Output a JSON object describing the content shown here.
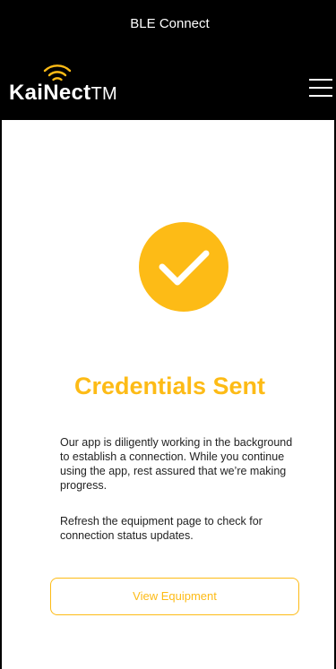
{
  "header": {
    "title": "BLE Connect",
    "logo_name": "KaiNect",
    "logo_mark": "TM",
    "menu_icon": "hamburger-menu-icon",
    "logo_icon": "wifi-signal-icon"
  },
  "main": {
    "status_icon": "checkmark-icon",
    "heading": "Credentials Sent",
    "paragraph_1": "Our app is diligently working in the background to establish a connection. While you continue using the app, rest assured that we’re making progress.",
    "paragraph_2": "Refresh the equipment page to check for connection status updates.",
    "button_label": "View Equipment"
  },
  "colors": {
    "accent": "#FDBB16",
    "header_bg": "#000000",
    "text": "#222222"
  }
}
